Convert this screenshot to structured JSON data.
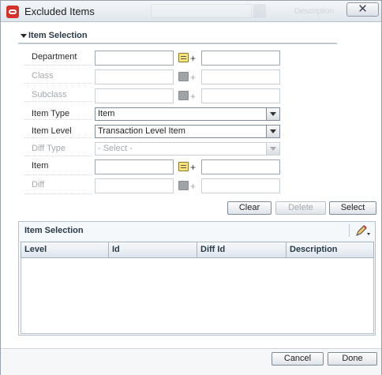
{
  "window": {
    "title": "Excluded Items",
    "close_glyph": "✕",
    "background_hint": "Description"
  },
  "criteria": {
    "section_title": "Item Selection",
    "fields": {
      "department": {
        "label": "Department",
        "value": "",
        "description": ""
      },
      "class": {
        "label": "Class",
        "value": "",
        "description": ""
      },
      "subclass": {
        "label": "Subclass",
        "value": "",
        "description": ""
      },
      "item_type": {
        "label": "Item Type",
        "value": "Item"
      },
      "item_level": {
        "label": "Item Level",
        "value": "Transaction Level Item"
      },
      "diff_type": {
        "label": "Diff Type",
        "value": "- Select -"
      },
      "item": {
        "label": "Item",
        "value": "",
        "description": ""
      },
      "diff": {
        "label": "Diff",
        "value": "",
        "description": ""
      }
    },
    "plus_glyph": "+",
    "buttons": {
      "clear": "Clear",
      "delete": "Delete",
      "select": "Select"
    }
  },
  "results": {
    "title": "Item Selection",
    "columns": [
      "Level",
      "Id",
      "Diff Id",
      "Description"
    ],
    "rows": []
  },
  "footer": {
    "cancel": "Cancel",
    "done": "Done"
  },
  "icons": {
    "app": "oracle-icon",
    "lookup_enabled": "list-lookup-icon",
    "lookup_disabled": "list-lookup-icon",
    "edit": "pencil-edit-icon",
    "collapse": "triangle-down-icon"
  },
  "colors": {
    "app_icon": "#d4322b",
    "lookup_enabled": "#fbe57a",
    "disabled_text": "#a3a9af",
    "panel_background": "#f4f8fb"
  }
}
